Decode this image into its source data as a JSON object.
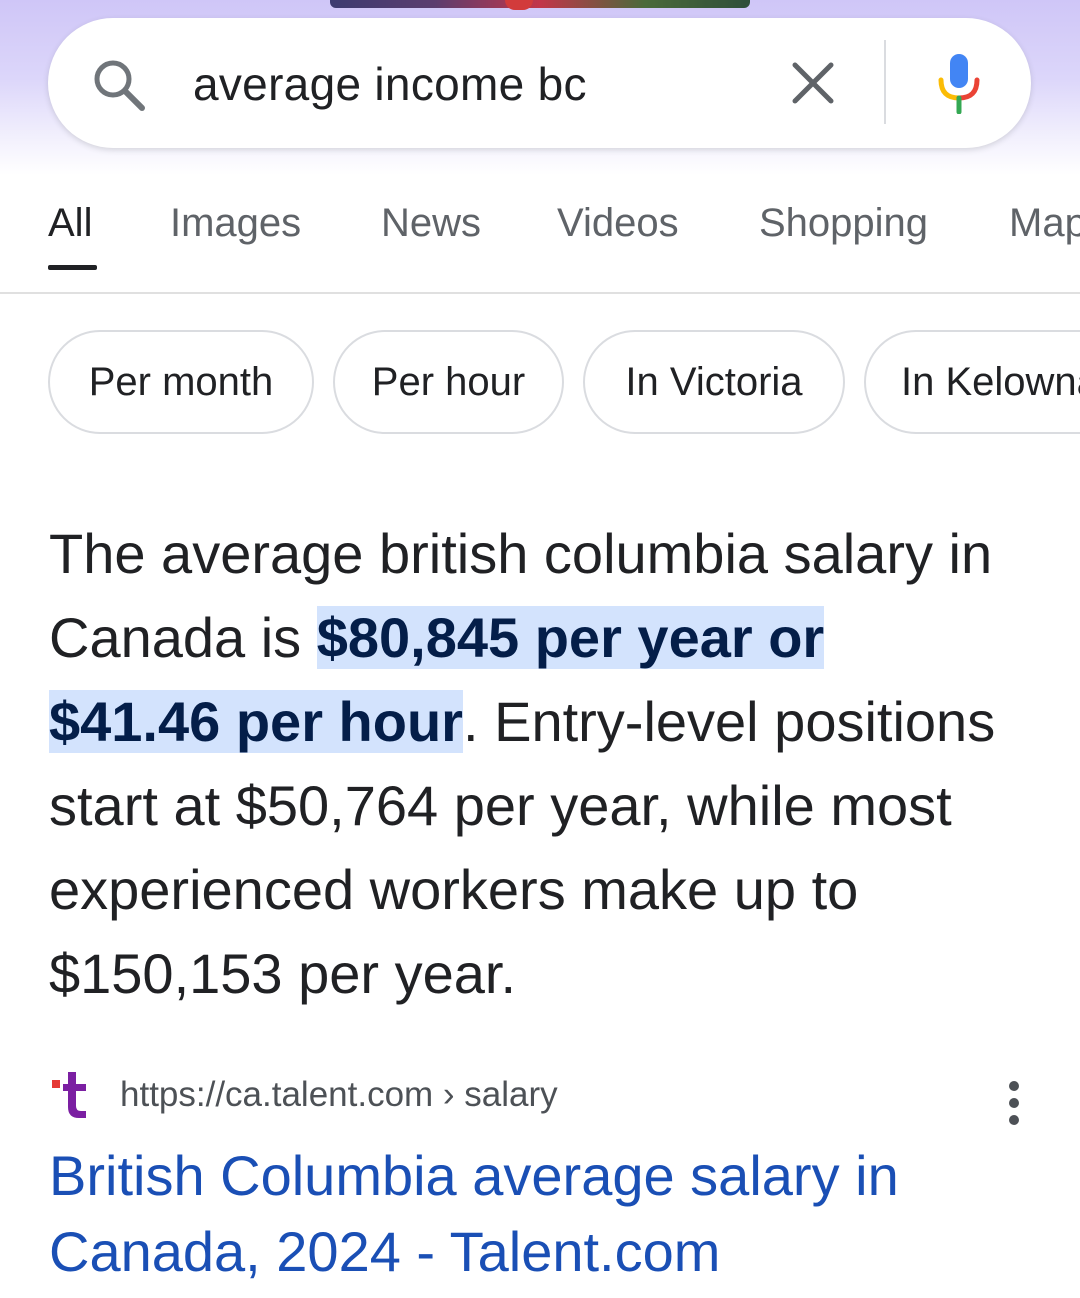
{
  "search": {
    "query": "average income bc"
  },
  "icons": {
    "search": "search-icon",
    "clear": "close-icon",
    "voice": "microphone-icon",
    "more": "more-vertical-icon",
    "favicon": "talent-favicon"
  },
  "tabs": [
    {
      "label": "All",
      "active": true
    },
    {
      "label": "Images",
      "active": false
    },
    {
      "label": "News",
      "active": false
    },
    {
      "label": "Videos",
      "active": false
    },
    {
      "label": "Shopping",
      "active": false
    },
    {
      "label": "Maps",
      "active": false
    }
  ],
  "chips": [
    {
      "label": "Per month"
    },
    {
      "label": "Per hour"
    },
    {
      "label": "In Victoria"
    },
    {
      "label": "In Kelowna"
    }
  ],
  "snippet": {
    "intro": "The average british columbia salary in Canada is ",
    "highlight_line1": "$80,845 per year or",
    "highlight_line2": "$41.46 per hour",
    "rest": ". Entry-level positions start at $50,764 per year, while most experienced workers make up to $150,153 per year."
  },
  "source": {
    "favicon_letter": "t",
    "url": "https://ca.talent.com › salary",
    "title": "British Columbia average salary in Canada, 2024 - Talent.com"
  },
  "colors": {
    "header_gradient_top": "#cfc6f7",
    "highlight_bg": "#d3e3fd",
    "highlight_text": "#041e49",
    "link_blue": "#1a4fb5",
    "favicon_purple": "#7b1fa2",
    "favicon_red": "#e53935"
  }
}
